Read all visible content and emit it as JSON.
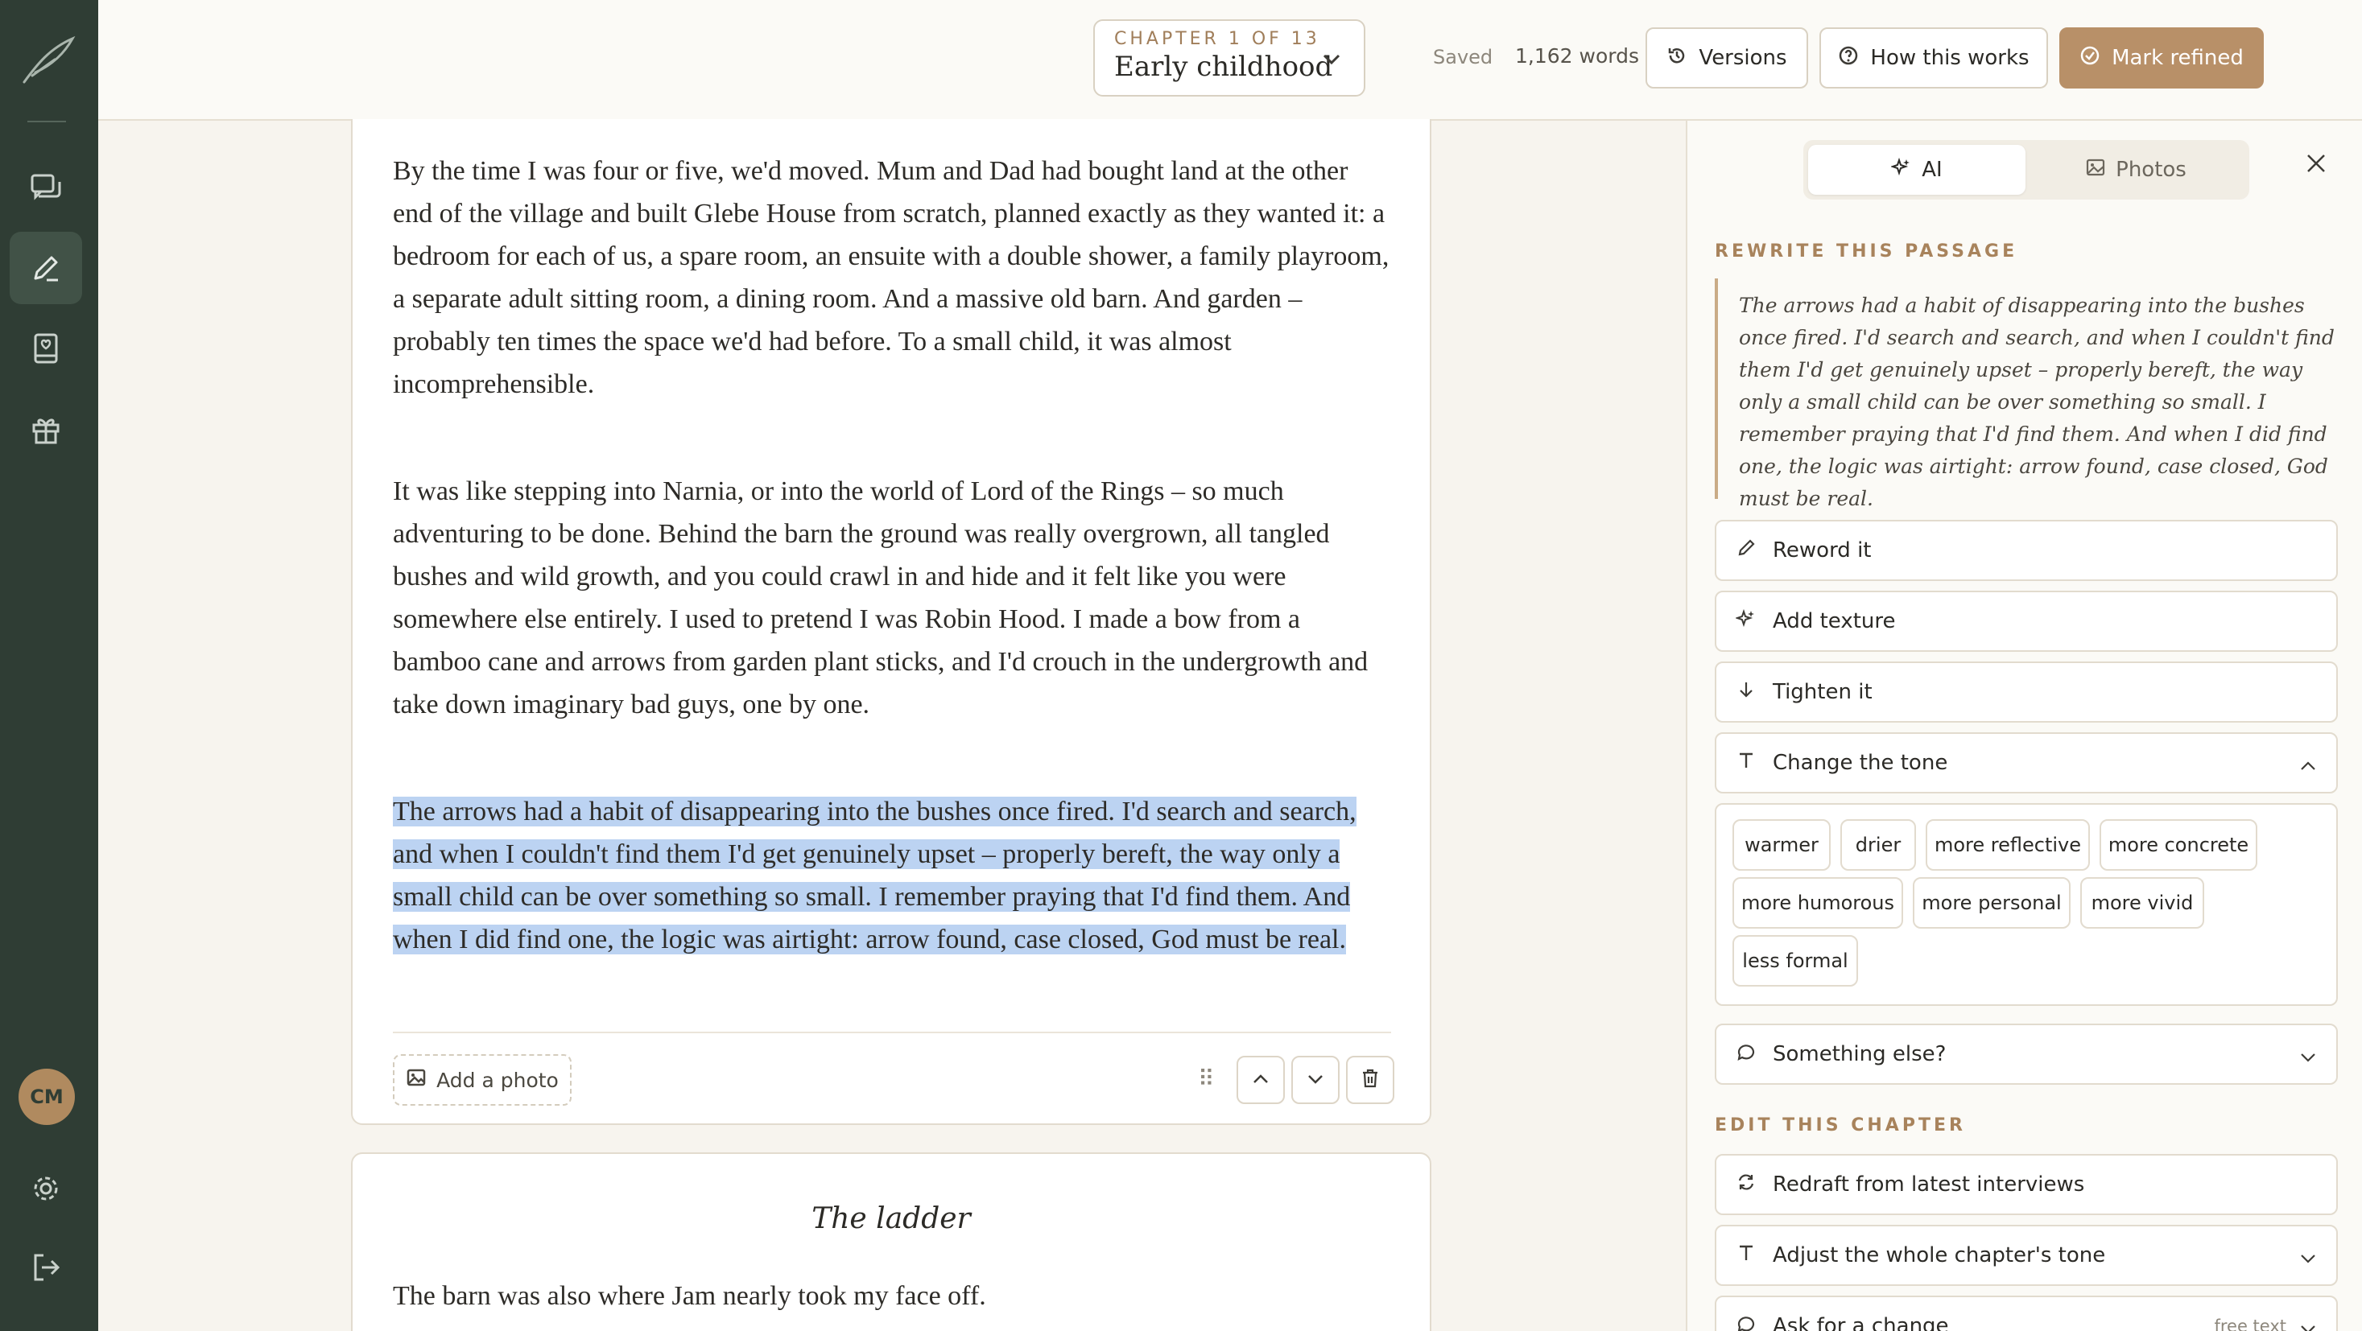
{
  "user": {
    "initials": "CM"
  },
  "topbar": {
    "chapter_kicker": "CHAPTER 1 OF 13",
    "chapter_name": "Early childhood",
    "saved": "Saved",
    "word_count": "1,162 words",
    "versions_label": "Versions",
    "how_label": "How this works",
    "refined_label": "Mark refined"
  },
  "editor": {
    "paragraphs": [
      "By the time I was four or five, we'd moved. Mum and Dad had bought land at the other end of the village and built Glebe House from scratch, planned exactly as they wanted it: a bedroom for each of us, a spare room, an ensuite with a double shower, a family playroom, a separate adult sitting room, a dining room. And a massive old barn. And garden – probably ten times the space we'd had before. To a small child, it was almost incomprehensible.",
      "It was like stepping into Narnia, or into the world of Lord of the Rings – so much adventuring to be done. Behind the barn the ground was really overgrown, all tangled bushes and wild growth, and you could crawl in and hide and it felt like you were somewhere else entirely. I used to pretend I was Robin Hood. I made a bow from a bamboo cane and arrows from garden plant sticks, and I'd crouch in the undergrowth and take down imaginary bad guys, one by one.",
      "The arrows had a habit of disappearing into the bushes once fired. I'd search and search, and when I couldn't find them I'd get genuinely upset – properly bereft, the way only a small child can be over something so small. I remember praying that I'd find them. And when I did find one, the logic was airtight: arrow found, case closed, God must be real."
    ],
    "add_photo_label": "Add a photo",
    "next_section": {
      "title": "The ladder",
      "paragraph": "The barn was also where Jam nearly took my face off."
    }
  },
  "panel": {
    "tabs": {
      "ai": "AI",
      "photos": "Photos"
    },
    "rewrite_heading": "REWRITE THIS PASSAGE",
    "quote": "The arrows had a habit of disappearing into the bushes once fired. I'd search and search, and when I couldn't find them I'd get genuinely upset – properly bereft, the way only a small child can be over something so small. I remember praying that I'd find them. And when I did find one, the logic was airtight: arrow found, case closed, God must be real.",
    "actions": {
      "reword": "Reword it",
      "texture": "Add texture",
      "tighten": "Tighten it",
      "tone": "Change the tone",
      "else": "Something else?"
    },
    "tones": [
      "warmer",
      "drier",
      "more reflective",
      "more concrete",
      "more humorous",
      "more personal",
      "more vivid",
      "less formal"
    ],
    "edit_heading": "EDIT THIS CHAPTER",
    "chapter_actions": {
      "redraft": "Redraft from latest interviews",
      "adjust": "Adjust the whole chapter's tone",
      "ask": "Ask for a change",
      "ask_tag": "free text"
    }
  },
  "colors": {
    "rail": "#2f3d34",
    "accent": "#b89068",
    "selection": "#bcd3f2"
  }
}
